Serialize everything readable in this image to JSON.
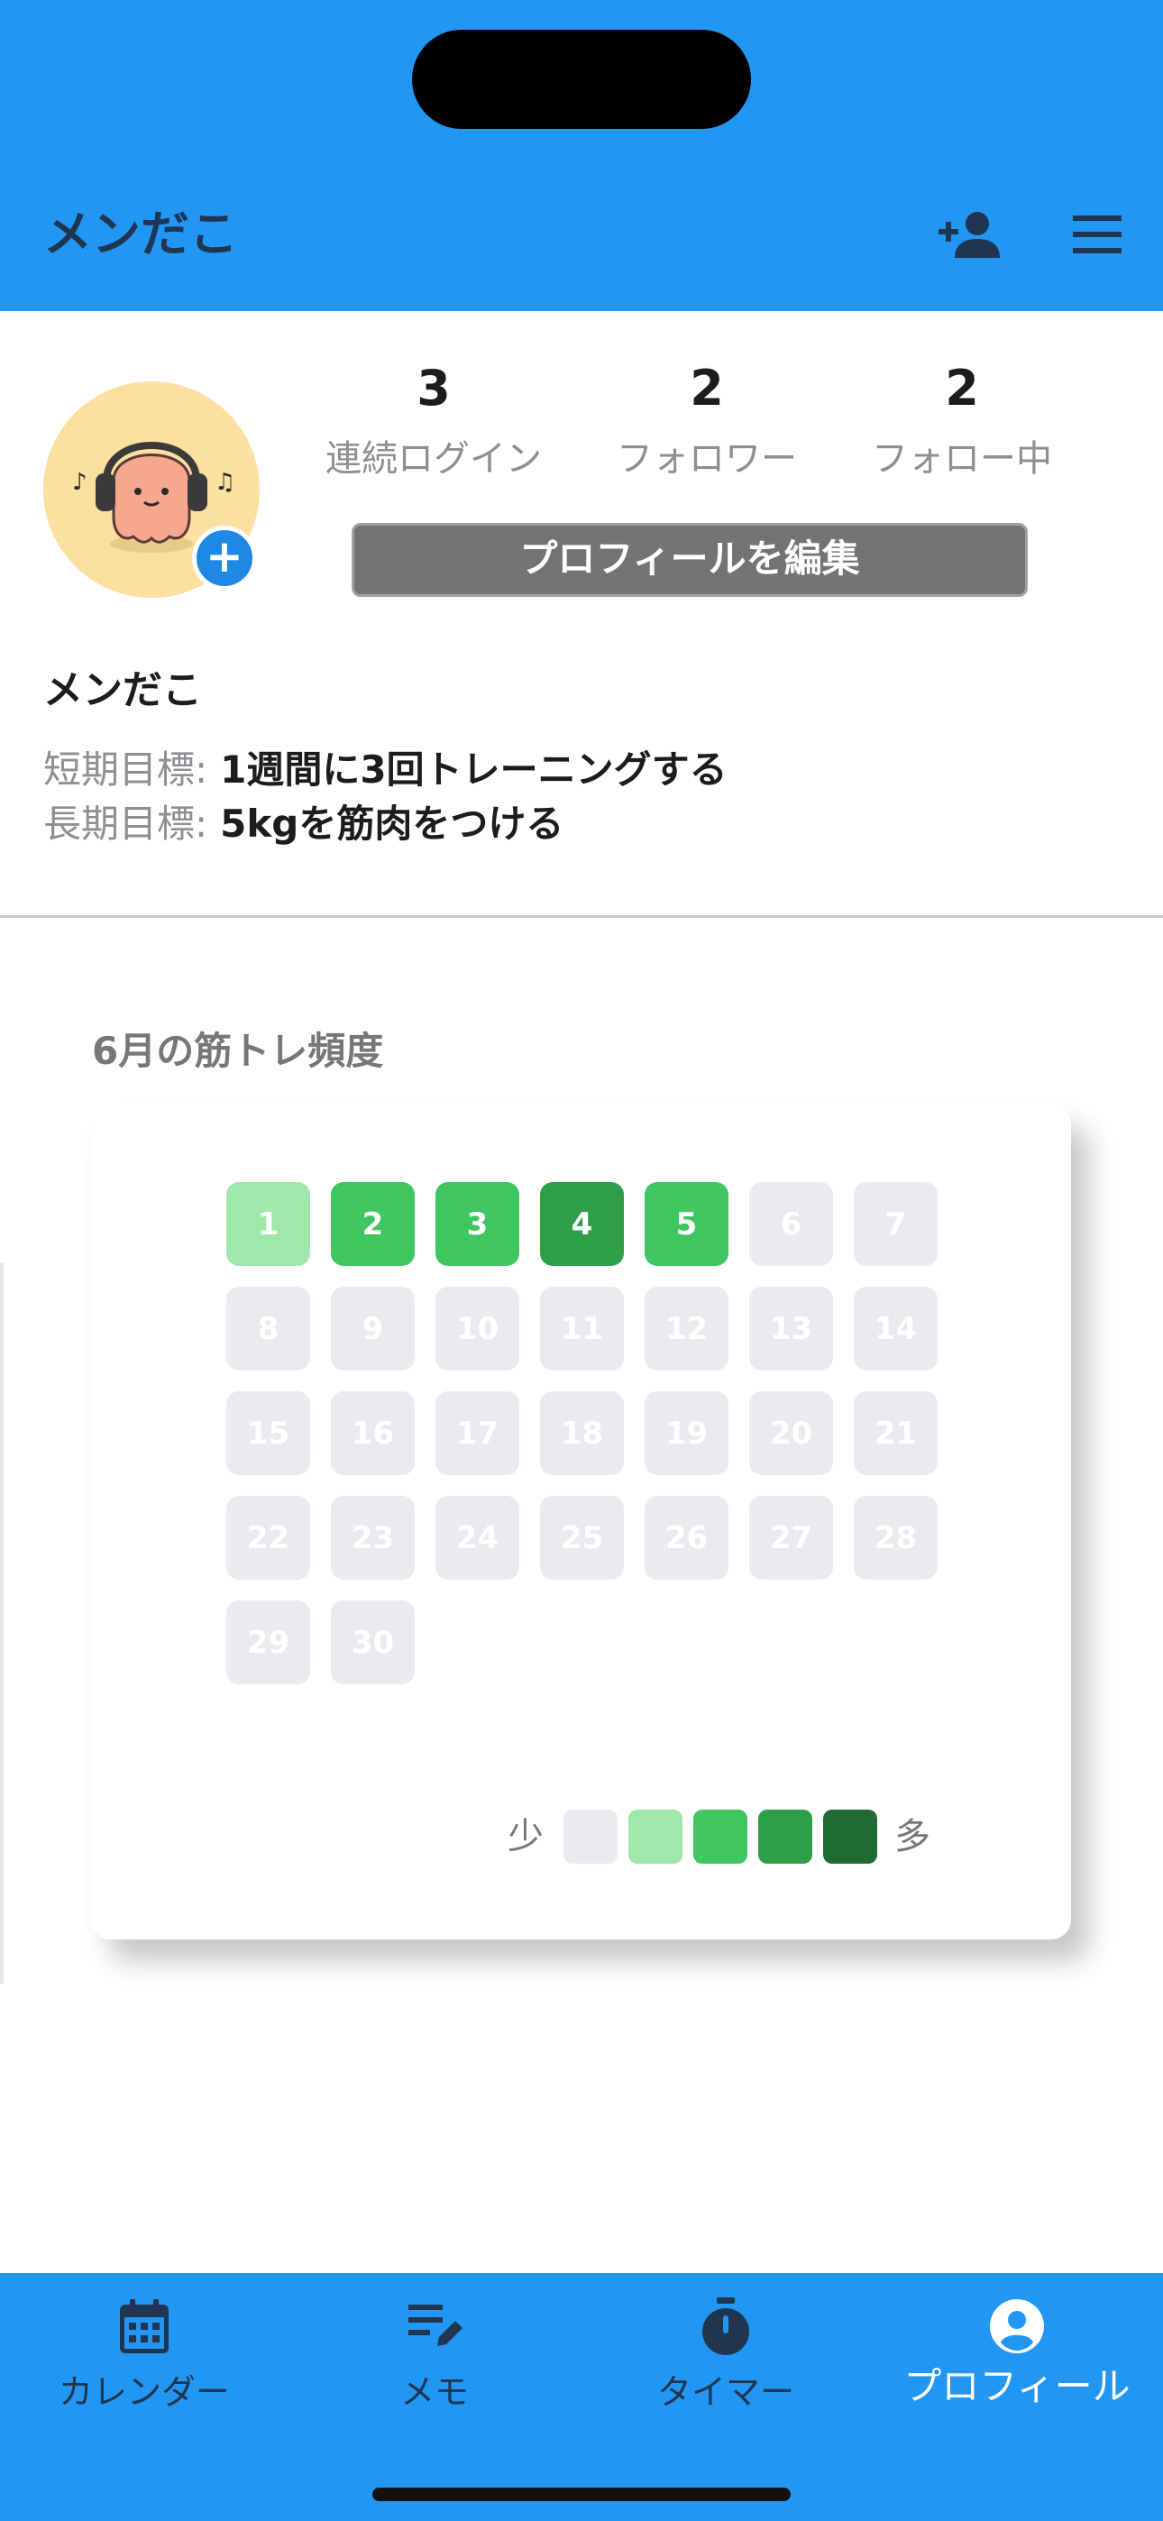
{
  "header": {
    "title": "メンだこ",
    "follow_icon": "person-add-icon",
    "menu_icon": "hamburger-menu-icon",
    "color": "#2196f3"
  },
  "profile": {
    "avatar_icon": "octopus-headphones-avatar",
    "add_badge": "+",
    "stats": [
      {
        "value": "3",
        "label": "連続ログイン"
      },
      {
        "value": "2",
        "label": "フォロワー"
      },
      {
        "value": "2",
        "label": "フォロー中"
      }
    ],
    "edit_button": "プロフィールを編集",
    "name": "メンだこ",
    "goals": [
      {
        "label": "短期目標:",
        "value": "1週間に3回トレーニングする"
      },
      {
        "label": "長期目標:",
        "value": "5kgを筋肉をつける"
      }
    ]
  },
  "heatmap": {
    "title": "6月の筋トレ頻度",
    "days": [
      {
        "day": "1",
        "level": 1
      },
      {
        "day": "2",
        "level": 2
      },
      {
        "day": "3",
        "level": 2
      },
      {
        "day": "4",
        "level": 3
      },
      {
        "day": "5",
        "level": 2
      },
      {
        "day": "6",
        "level": 0
      },
      {
        "day": "7",
        "level": 0
      },
      {
        "day": "8",
        "level": 0
      },
      {
        "day": "9",
        "level": 0
      },
      {
        "day": "10",
        "level": 0
      },
      {
        "day": "11",
        "level": 0
      },
      {
        "day": "12",
        "level": 0
      },
      {
        "day": "13",
        "level": 0
      },
      {
        "day": "14",
        "level": 0
      },
      {
        "day": "15",
        "level": 0
      },
      {
        "day": "16",
        "level": 0
      },
      {
        "day": "17",
        "level": 0
      },
      {
        "day": "18",
        "level": 0
      },
      {
        "day": "19",
        "level": 0
      },
      {
        "day": "20",
        "level": 0
      },
      {
        "day": "21",
        "level": 0
      },
      {
        "day": "22",
        "level": 0
      },
      {
        "day": "23",
        "level": 0
      },
      {
        "day": "24",
        "level": 0
      },
      {
        "day": "25",
        "level": 0
      },
      {
        "day": "26",
        "level": 0
      },
      {
        "day": "27",
        "level": 0
      },
      {
        "day": "28",
        "level": 0
      },
      {
        "day": "29",
        "level": 0
      },
      {
        "day": "30",
        "level": 0
      }
    ],
    "level_colors": [
      "#ebebef",
      "#9fe8aa",
      "#3fc661",
      "#2f9e48",
      "#1f6b34"
    ],
    "legend": {
      "low": "少",
      "high": "多"
    }
  },
  "tabs": [
    {
      "label": "カレンダー",
      "icon": "calendar-icon",
      "active": false
    },
    {
      "label": "メモ",
      "icon": "memo-edit-icon",
      "active": false
    },
    {
      "label": "タイマー",
      "icon": "stopwatch-icon",
      "active": false
    },
    {
      "label": "プロフィール",
      "icon": "profile-icon",
      "active": true
    }
  ]
}
